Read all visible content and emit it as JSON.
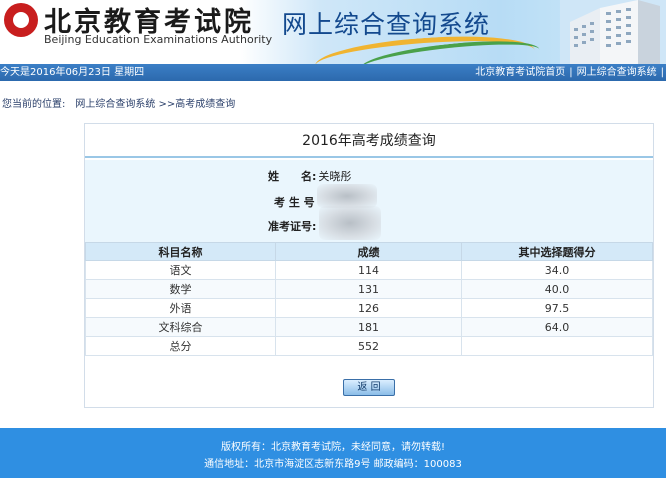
{
  "header": {
    "logo_cn": "北京教育考试院",
    "logo_en": "Beijing Education Examinations Authority",
    "site_title": "网上综合查询系统"
  },
  "navbar": {
    "date_text": "今天是2016年06月23日 星期四",
    "links": [
      "北京教育考试院首页",
      "网上综合查询系统"
    ],
    "separator": "|"
  },
  "breadcrumb": {
    "prefix": "您当前的位置:",
    "path": "网上综合查询系统 >>高考成绩查询"
  },
  "panel": {
    "title": "2016年高考成绩查询",
    "info": {
      "name_label": "姓　　名:",
      "name_value": "关晓彤",
      "exam_no_label": "考 生 号",
      "admission_label": "准考证号:"
    },
    "table": {
      "headers": [
        "科目名称",
        "成绩",
        "其中选择题得分"
      ],
      "rows": [
        [
          "语文",
          "114",
          "34.0"
        ],
        [
          "数学",
          "131",
          "40.0"
        ],
        [
          "外语",
          "126",
          "97.5"
        ],
        [
          "文科综合",
          "181",
          "64.0"
        ],
        [
          "总分",
          "552",
          ""
        ]
      ]
    },
    "return_label": "返 回"
  },
  "footer": {
    "line1": "版权所有：北京教育考试院，未经同意，请勿转载!",
    "line2": "通信地址：北京市海淀区志新东路9号 邮政编码：100083"
  },
  "colors": {
    "navbar": "#2c69ad",
    "footer": "#2f8fe2",
    "table_header": "#d4e9f8",
    "info_bg": "#eaf6fd"
  }
}
